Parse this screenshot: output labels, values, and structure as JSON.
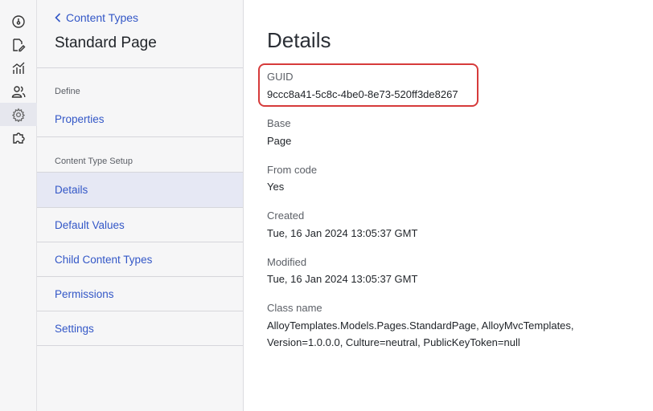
{
  "rail": {
    "items": [
      {
        "name": "dashboard-icon"
      },
      {
        "name": "edit-page-icon"
      },
      {
        "name": "analytics-icon"
      },
      {
        "name": "users-icon"
      },
      {
        "name": "settings-icon",
        "active": true
      },
      {
        "name": "addons-icon"
      }
    ]
  },
  "sidebar": {
    "back_label": "Content Types",
    "title": "Standard Page",
    "sections": {
      "define": "Define",
      "setup": "Content Type Setup"
    },
    "items": [
      {
        "label": "Properties"
      },
      {
        "label": "Details",
        "active": true
      },
      {
        "label": "Default Values"
      },
      {
        "label": "Child Content Types"
      },
      {
        "label": "Permissions"
      },
      {
        "label": "Settings"
      }
    ]
  },
  "main": {
    "title": "Details",
    "fields": [
      {
        "label": "GUID",
        "value": "9ccc8a41-5c8c-4be0-8e73-520ff3de8267"
      },
      {
        "label": "Base",
        "value": "Page"
      },
      {
        "label": "From code",
        "value": "Yes"
      },
      {
        "label": "Created",
        "value": "Tue, 16 Jan 2024 13:05:37 GMT"
      },
      {
        "label": "Modified",
        "value": "Tue, 16 Jan 2024 13:05:37 GMT"
      },
      {
        "label": "Class name",
        "value_line1": "AlloyTemplates.Models.Pages.StandardPage, AlloyMvcTemplates,",
        "value_line2": "Version=1.0.0.0, Culture=neutral, PublicKeyToken=null"
      }
    ]
  },
  "colors": {
    "link": "#3357c7",
    "highlight": "#d63b3b",
    "active_bg": "#e6e8f4"
  }
}
